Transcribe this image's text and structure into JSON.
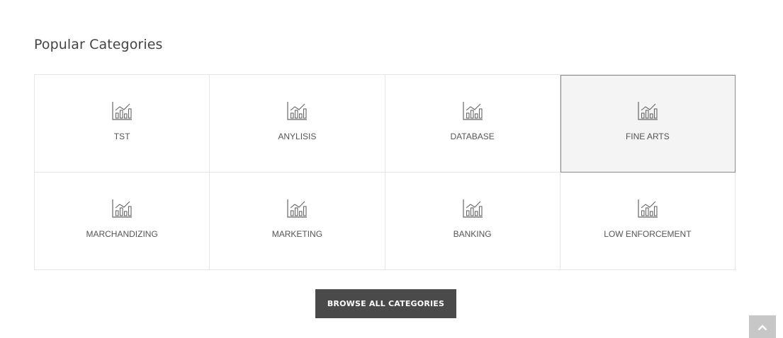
{
  "section": {
    "title": "Popular Categories"
  },
  "categories": [
    {
      "label": "TST",
      "icon": "bar-chart-icon"
    },
    {
      "label": "ANYLISIS",
      "icon": "bar-chart-icon"
    },
    {
      "label": "DATABASE",
      "icon": "bar-chart-icon"
    },
    {
      "label": "FINE ARTS",
      "icon": "bar-chart-icon",
      "active": true
    },
    {
      "label": "MARCHANDIZING",
      "icon": "bar-chart-icon"
    },
    {
      "label": "MARKETING",
      "icon": "bar-chart-icon"
    },
    {
      "label": "BANKING",
      "icon": "bar-chart-icon"
    },
    {
      "label": "LOW ENFORCEMENT",
      "icon": "bar-chart-icon"
    }
  ],
  "browse": {
    "label": "BROWSE ALL CATEGORIES"
  },
  "scroll_top": {
    "icon": "chevron-up-icon"
  },
  "colors": {
    "button_bg": "#4a4a4a",
    "active_cell_bg": "#f4f4f4",
    "scroll_top_bg": "#c7c7c7"
  }
}
